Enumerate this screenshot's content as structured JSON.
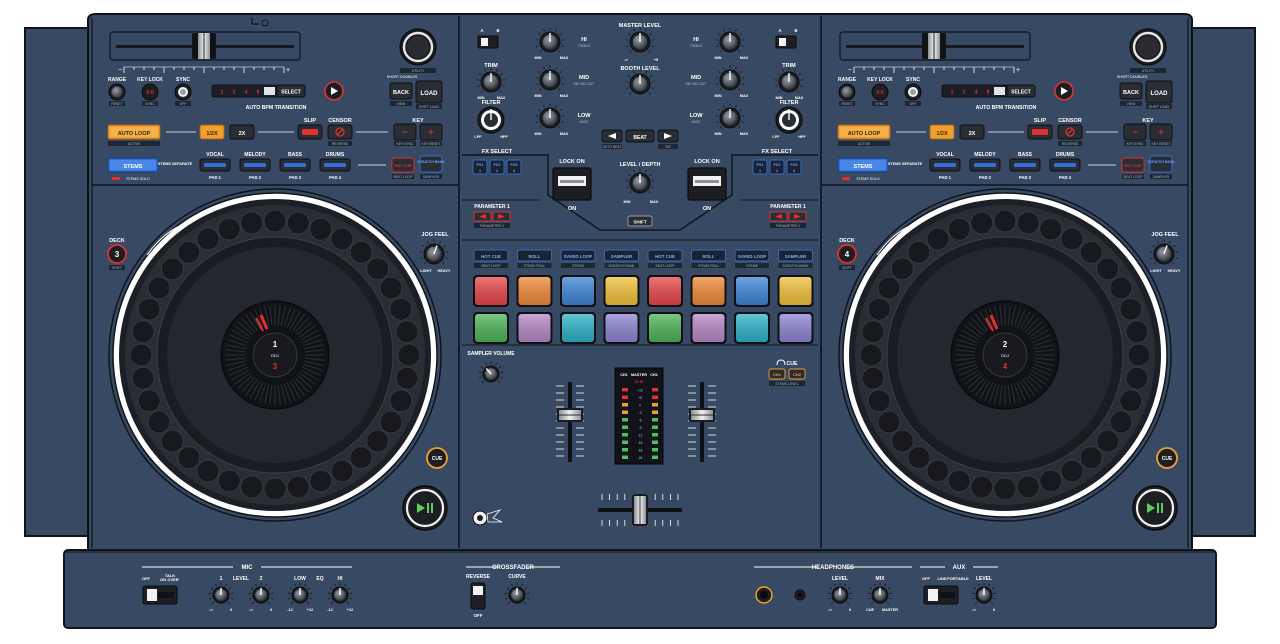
{
  "colors": {
    "body": "#384a63",
    "outline": "#0f141b",
    "accent_blue": "#2f6fd6",
    "accent_orange": "#f0a030",
    "accent_red": "#e03030"
  },
  "top_icon": "timer-icon",
  "decks": [
    {
      "side": "left",
      "deck_label": "DECK",
      "deck_number": "3",
      "deck_sub": "SHIFT",
      "range": "RANGE",
      "range_sub": "RESET",
      "key_lock": "KEY LOCK",
      "key_lock_button": "0-0",
      "key_lock_sub": "SYNC",
      "sync": "SYNC",
      "sync_sub": "OFF",
      "beat_nums": [
        "1",
        "2",
        "4",
        "8"
      ],
      "select": "SELECT",
      "auto_bpm": "AUTO BPM TRANSITION",
      "back": "BACK",
      "back_sub": "VIEW",
      "load": "LOAD",
      "load_sub": "SHIFT LOAD",
      "utility": "UTILITY",
      "browse": "SHORT DOUBLES",
      "auto_loop": "AUTO LOOP",
      "auto_loop_sub": "ACTIVE",
      "half": "1/2X",
      "double": "2X",
      "slip": "SLIP",
      "censor": "CENSOR",
      "censor_sub": "REVERSE",
      "key": "KEY",
      "key_minus": "−",
      "key_plus": "+",
      "key_sub_left": "KEY SYNC",
      "key_sub_right": "KEY RESET",
      "stems": "STEMS",
      "stems_separate": "STEMS SEPARATE",
      "stems_solo": "STEMS SOLO",
      "parts": [
        {
          "name": "VOCAL",
          "pad": "PAD 1"
        },
        {
          "name": "MELODY",
          "pad": "PAD 2"
        },
        {
          "name": "BASS",
          "pad": "PAD 3"
        },
        {
          "name": "DRUMS",
          "pad": "PAD 4"
        }
      ],
      "hot_cue": "HOT CUE",
      "hot_cue_sub": "BEAT LOOP",
      "scratch_bank": "SCRATCH BANK",
      "scratch_bank_sub": "SAMPLER",
      "jog_feel": "JOG FEEL",
      "jog_light": "LIGHT",
      "jog_heavy": "HEAVY",
      "jog_top": "1",
      "jog_bottom": "3",
      "jog_brand": "DDJ",
      "cue": "CUE",
      "play_icon": "play-pause-icon"
    },
    {
      "side": "right",
      "deck_label": "DECK",
      "deck_number": "4",
      "deck_sub": "SHIFT",
      "range": "RANGE",
      "range_sub": "RESET",
      "key_lock": "KEY LOCK",
      "key_lock_button": "0-0",
      "key_lock_sub": "SYNC",
      "sync": "SYNC",
      "sync_sub": "OFF",
      "beat_nums": [
        "1",
        "2",
        "4",
        "8"
      ],
      "select": "SELECT",
      "auto_bpm": "AUTO BPM TRANSITION",
      "back": "BACK",
      "back_sub": "VIEW",
      "load": "LOAD",
      "load_sub": "SHIFT LOAD",
      "utility": "UTILITY",
      "browse": "SHORT DOUBLES",
      "auto_loop": "AUTO LOOP",
      "auto_loop_sub": "ACTIVE",
      "half": "1/2X",
      "double": "2X",
      "slip": "SLIP",
      "censor": "CENSOR",
      "censor_sub": "REVERSE",
      "key": "KEY",
      "key_minus": "−",
      "key_plus": "+",
      "key_sub_left": "KEY SYNC",
      "key_sub_right": "KEY RESET",
      "stems": "STEMS",
      "stems_separate": "STEMS SEPARATE",
      "stems_solo": "STEMS SOLO",
      "parts": [
        {
          "name": "VOCAL",
          "pad": "PAD 1"
        },
        {
          "name": "MELODY",
          "pad": "PAD 2"
        },
        {
          "name": "BASS",
          "pad": "PAD 3"
        },
        {
          "name": "DRUMS",
          "pad": "PAD 4"
        }
      ],
      "hot_cue": "HOT CUE",
      "hot_cue_sub": "BEAT LOOP",
      "scratch_bank": "SCRATCH BANK",
      "scratch_bank_sub": "SAMPLER",
      "jog_feel": "JOG FEEL",
      "jog_light": "LIGHT",
      "jog_heavy": "HEAVY",
      "jog_top": "2",
      "jog_bottom": "4",
      "jog_brand": "DDJ",
      "cue": "CUE",
      "play_icon": "play-pause-icon"
    }
  ],
  "mixer": {
    "master_level": "MASTER LEVEL",
    "booth_level": "BOOTH LEVEL",
    "master_min": "-∞",
    "master_max": "+5",
    "trim": "TRIM",
    "filter": "FILTER",
    "lpf": "LPF",
    "hpf": "HPF",
    "min": "MIN",
    "max": "MAX",
    "eq": [
      {
        "name": "HI",
        "sub": "TREBLE"
      },
      {
        "name": "MID",
        "sub": "MID MELODY"
      },
      {
        "name": "LOW",
        "sub": "BASS"
      }
    ],
    "switch_labels": [
      "A",
      "B"
    ],
    "beat": "BEAT",
    "beat_left_sub": "AUTO BEAT",
    "beat_right_sub": "TAP",
    "fx_select": "FX SELECT",
    "fx_buttons": [
      "FX1",
      "FX2",
      "FX3"
    ],
    "fx_buttons_sub": [
      "1",
      "2",
      "3"
    ],
    "lock_on": "LOCK ON",
    "on": "ON",
    "level_depth": "LEVEL / DEPTH",
    "shift": "SHIFT",
    "parameter": "PARAMETER 1",
    "parameter_sub": "PARAMETER 2",
    "pad_modes_left": [
      {
        "label": "HOT CUE",
        "sub": "BEAT LOOP"
      },
      {
        "label": "ROLL",
        "sub": "STEMS ROLL"
      },
      {
        "label": "SAVED LOOP",
        "sub": "STEMS"
      },
      {
        "label": "SAMPLER",
        "sub": "SCRATCH BANK"
      }
    ],
    "pad_modes_right": [
      {
        "label": "HOT CUE",
        "sub": "BEAT LOOP"
      },
      {
        "label": "ROLL",
        "sub": "STEMS ROLL"
      },
      {
        "label": "SAVED LOOP",
        "sub": "STEMS"
      },
      {
        "label": "SAMPLER",
        "sub": "SCRATCH BANK"
      }
    ],
    "pad_colors_top": [
      "#e8484a",
      "#f08a3a",
      "#3f86d6",
      "#f2c23c",
      "#e8484a",
      "#f08a3a",
      "#3f86d6",
      "#f2c23c"
    ],
    "pad_colors_bottom": [
      "#4fb45c",
      "#b789c8",
      "#2eb3c8",
      "#8f86d3",
      "#4fb45c",
      "#b789c8",
      "#2eb3c8",
      "#8f86d3"
    ],
    "sampler_volume": "SAMPLER VOLUME",
    "meter_header": [
      "CH1",
      "MASTER",
      "CH2"
    ],
    "meter_clip": "CLIP",
    "meter_scale": [
      "+12",
      "+6",
      "0",
      "-3",
      "-6",
      "-9",
      "-12",
      "-15",
      "-18",
      "-24"
    ],
    "headphone_cue": "CUE",
    "cue_buttons": [
      "CH1",
      "CH2"
    ],
    "cue_sub": "STEMS LEVEL",
    "headphone_icon": "headphone-icon",
    "logo_icon": "brand-logo-icon"
  },
  "bottom": {
    "mic_title": "MIC",
    "mic_switch_off": "OFF",
    "mic_switch_talk": "TALK",
    "mic_switch_on": "ON",
    "mic_switch_over": "OVER",
    "mic1": "1",
    "mic2": "2",
    "level": "LEVEL",
    "low": "LOW",
    "eq": "EQ",
    "hi": "HI",
    "minus_inf": "-∞",
    "zero": "0",
    "minus12": "-12",
    "plus12": "+12",
    "crossfader_title": "CROSSFADER",
    "reverse": "REVERSE",
    "curve": "CURVE",
    "off": "OFF",
    "headphones_title": "HEADPHONES",
    "mix": "MIX",
    "cue": "CUE",
    "master": "MASTER",
    "aux_title": "AUX",
    "aux_off": "OFF",
    "aux_line": "LINE",
    "aux_portable": "PORTABLE",
    "aux_level": "LEVEL"
  }
}
